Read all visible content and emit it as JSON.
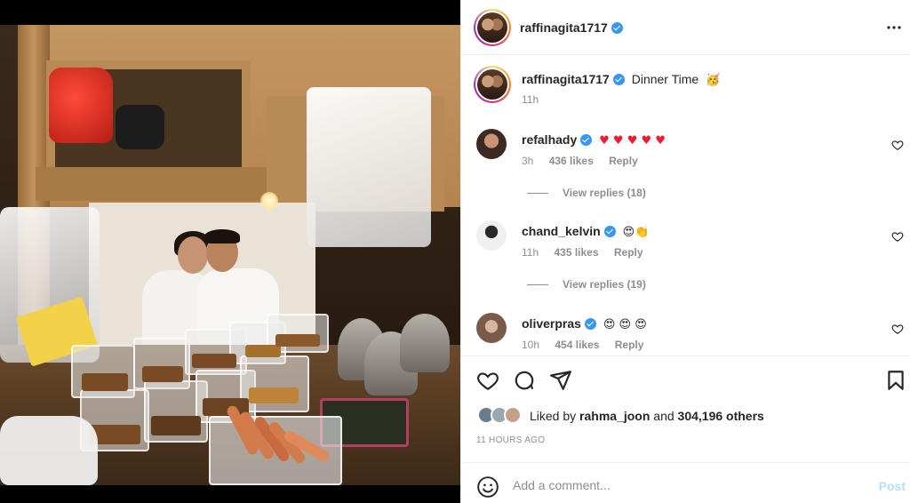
{
  "post": {
    "author": "raffinagita1717",
    "caption_text": "Dinner Time",
    "caption_emoji": "🥳",
    "caption_time": "11h",
    "photo_alt": "Photo of a couple at a night food stall"
  },
  "comments": [
    {
      "user": "refalhady",
      "text": "♥ ♥ ♥ ♥ ♥",
      "time": "3h",
      "likes": "436 likes",
      "reply": "Reply",
      "view_replies": "View replies (18)",
      "avatar_color": "#7a4a3a"
    },
    {
      "user": "chand_kelvin",
      "text": "😍👏",
      "time": "11h",
      "likes": "435 likes",
      "reply": "Reply",
      "view_replies": "View replies (19)",
      "avatar_color": "#d9d9d9"
    },
    {
      "user": "oliverpras",
      "text": "😍 😍 😍",
      "time": "10h",
      "likes": "454 likes",
      "reply": "Reply",
      "avatar_color": "#a88a7a"
    }
  ],
  "likes": {
    "prefix": "Liked by",
    "user": "rahma_joon",
    "and": "and",
    "others": "304,196 others"
  },
  "timestamp": "11 HOURS AGO",
  "add_comment": {
    "placeholder": "Add a comment...",
    "post_label": "Post"
  },
  "icons": {
    "more": "more-icon",
    "like": "heart-icon",
    "comment": "comment-icon",
    "share": "share-icon",
    "save": "bookmark-icon",
    "emoji": "emoji-icon"
  },
  "colors": {
    "verified": "#3897f0",
    "heart_emoji": "#ed1c2e",
    "muted": "#8e8e8e",
    "post_disabled": "#b2dffc"
  }
}
